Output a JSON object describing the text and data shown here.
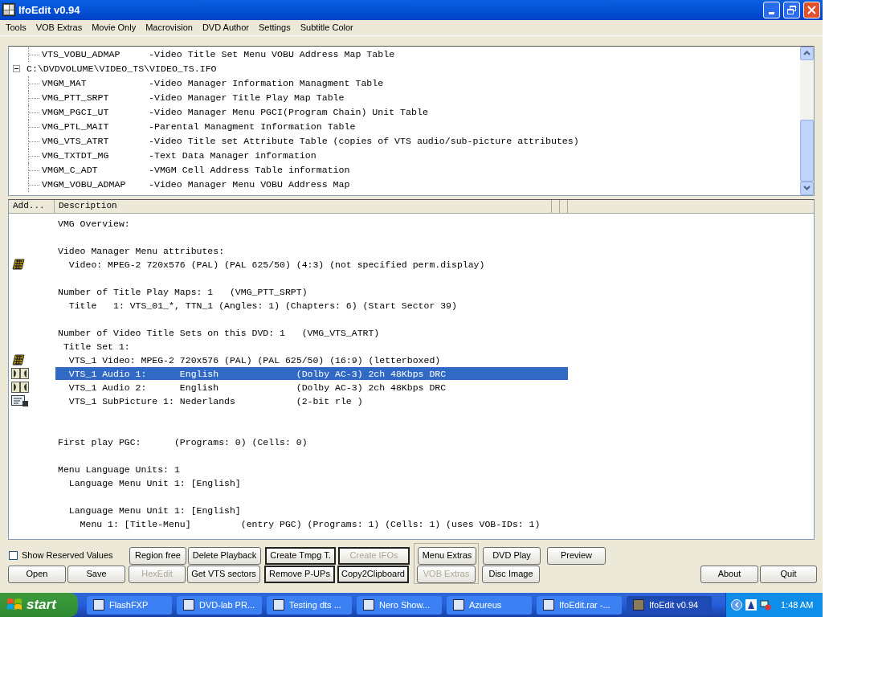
{
  "window": {
    "title": "IfoEdit v0.94"
  },
  "menu": [
    "Tools",
    "VOB Extras",
    "Movie Only",
    "Macrovision",
    "DVD Author",
    "Settings",
    "Subtitle Color"
  ],
  "tree": [
    {
      "children": [
        {
          "name": "VTS_VOBU_ADMAP",
          "description": "-Video Title Set Menu VOBU Address Map Table"
        }
      ]
    },
    {
      "name": "C:\\DVDVOLUME\\VIDEO_TS\\VIDEO_TS.IFO",
      "expanded": true,
      "children": [
        {
          "name": "VMGM_MAT",
          "description": "-Video Manager Information Managment Table"
        },
        {
          "name": "VMG_PTT_SRPT",
          "description": "-Video Manager Title Play Map Table"
        },
        {
          "name": "VMGM_PGCI_UT",
          "description": "-Video Manager Menu PGCI(Program Chain) Unit Table"
        },
        {
          "name": "VMG_PTL_MAIT",
          "description": "-Parental Managment Information Table"
        },
        {
          "name": "VMG_VTS_ATRT",
          "description": "-Video Title set Attribute Table (copies of VTS audio/sub-picture attributes)"
        },
        {
          "name": "VMG_TXTDT_MG",
          "description": "-Text Data Manager information"
        },
        {
          "name": "VMGM_C_ADT",
          "description": "-VMGM Cell Address Table information"
        },
        {
          "name": "VMGM_VOBU_ADMAP",
          "description": "-Video Manager Menu VOBU Address Map"
        }
      ]
    }
  ],
  "list": {
    "columns": [
      "Add...",
      "Description"
    ],
    "rows": [
      {
        "kind": "text",
        "text": "VMG Overview:",
        "selected": false
      },
      {
        "kind": "blank"
      },
      {
        "kind": "text",
        "text": "Video Manager Menu attributes:",
        "selected": false
      },
      {
        "kind": "video",
        "text": "  Video: MPEG-2 720x576 (PAL) (PAL 625/50) (4:3) (not specified perm.display)",
        "selected": false
      },
      {
        "kind": "blank"
      },
      {
        "kind": "text",
        "text": "Number of Title Play Maps: 1   (VMG_PTT_SRPT)",
        "selected": false
      },
      {
        "kind": "text",
        "text": "  Title   1: VTS_01_*, TTN_1 (Angles: 1) (Chapters: 6) (Start Sector 39)",
        "selected": false
      },
      {
        "kind": "blank"
      },
      {
        "kind": "text",
        "text": "Number of Video Title Sets on this DVD: 1   (VMG_VTS_ATRT)",
        "selected": false
      },
      {
        "kind": "text",
        "text": " Title Set 1:",
        "selected": false
      },
      {
        "kind": "video",
        "text": "  VTS_1 Video: MPEG-2 720x576 (PAL) (PAL 625/50) (16:9) (letterboxed)",
        "selected": false
      },
      {
        "kind": "audio",
        "text": "  VTS_1 Audio 1:      English              (Dolby AC-3) 2ch 48Kbps DRC",
        "selected": true
      },
      {
        "kind": "audio",
        "text": "  VTS_1 Audio 2:      English              (Dolby AC-3) 2ch 48Kbps DRC",
        "selected": false
      },
      {
        "kind": "subpicture",
        "text": "  VTS_1 SubPicture 1: Nederlands           (2-bit rle )",
        "selected": false
      },
      {
        "kind": "blank"
      },
      {
        "kind": "blank"
      },
      {
        "kind": "text",
        "text": "First play PGC:      (Programs: 0) (Cells: 0)",
        "selected": false
      },
      {
        "kind": "blank"
      },
      {
        "kind": "text",
        "text": "Menu Language Units: 1",
        "selected": false
      },
      {
        "kind": "text",
        "text": "  Language Menu Unit 1: [English]",
        "selected": false
      },
      {
        "kind": "blank"
      },
      {
        "kind": "text",
        "text": "  Language Menu Unit 1: [English]",
        "selected": false
      },
      {
        "kind": "text",
        "text": "    Menu 1: [Title-Menu]         (entry PGC) (Programs: 1) (Cells: 1) (uses VOB-IDs: 1)",
        "selected": false
      }
    ]
  },
  "show_reserved_values": {
    "label": "Show Reserved Values",
    "checked": false
  },
  "top_buttons": [
    {
      "label": "Region free",
      "disabled": false,
      "bordered": false
    },
    {
      "label": "Delete Playback",
      "disabled": false,
      "bordered": false
    },
    {
      "label": "Create Tmpg T.",
      "disabled": false,
      "bordered": true
    },
    {
      "label": "Create IFOs",
      "disabled": true,
      "bordered": true
    },
    {
      "label": "Menu Extras",
      "disabled": false,
      "bordered": false
    },
    {
      "label": "DVD Play",
      "disabled": false,
      "bordered": false
    },
    {
      "label": "Preview",
      "disabled": false,
      "bordered": false
    }
  ],
  "bottom_buttons": [
    {
      "label": "Open",
      "disabled": false,
      "bordered": false
    },
    {
      "label": "Save",
      "disabled": false,
      "bordered": false
    },
    {
      "label": "HexEdit",
      "disabled": true,
      "bordered": false
    },
    {
      "label": "Get VTS sectors",
      "disabled": false,
      "bordered": false
    },
    {
      "label": "Remove P-UPs",
      "disabled": false,
      "bordered": true
    },
    {
      "label": "Copy2Clipboard",
      "disabled": false,
      "bordered": true
    },
    {
      "label": "VOB Extras",
      "disabled": true,
      "bordered": false
    },
    {
      "label": "Disc Image",
      "disabled": false,
      "bordered": false
    },
    {
      "label": "About",
      "disabled": false,
      "bordered": false
    },
    {
      "label": "Quit",
      "disabled": false,
      "bordered": false
    }
  ],
  "taskbar": {
    "start": "start",
    "tasks": [
      {
        "label": "FlashFXP",
        "selected": false
      },
      {
        "label": "DVD-lab PR...",
        "selected": false
      },
      {
        "label": "Testing dts ...",
        "selected": false
      },
      {
        "label": "Nero Show...",
        "selected": false
      },
      {
        "label": "Azureus",
        "selected": false
      },
      {
        "label": "IfoEdit.rar -...",
        "selected": false
      },
      {
        "label": "IfoEdit v0.94",
        "selected": true
      }
    ],
    "clock": "1:48 AM"
  }
}
